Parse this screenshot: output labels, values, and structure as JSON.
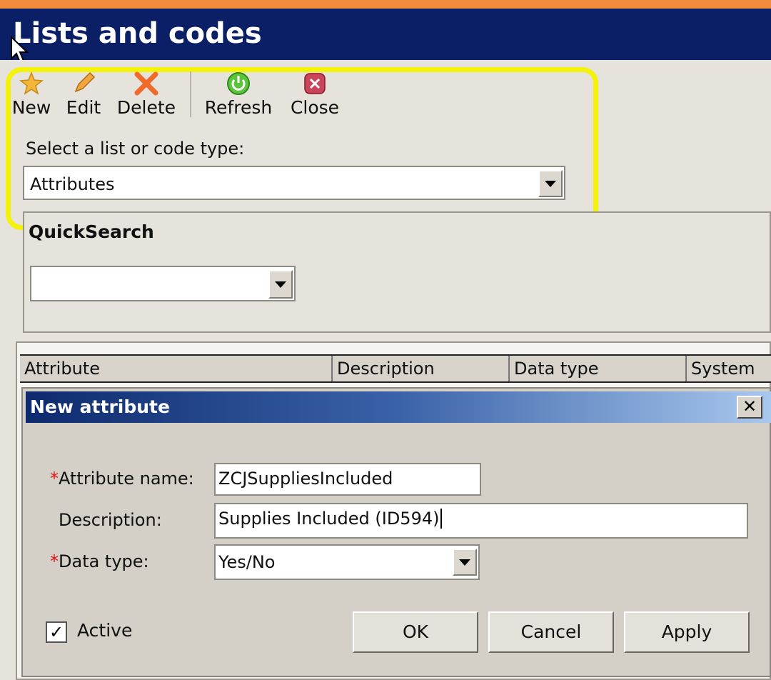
{
  "window": {
    "title": "Lists and codes"
  },
  "toolbar": {
    "new_label": "New",
    "edit_label": "Edit",
    "delete_label": "Delete",
    "refresh_label": "Refresh",
    "close_label": "Close"
  },
  "list_select": {
    "label": "Select a list or code type:",
    "value": "Attributes"
  },
  "quicksearch": {
    "label": "QuickSearch",
    "value": ""
  },
  "grid": {
    "columns": [
      "Attribute",
      "Description",
      "Data type",
      "System"
    ]
  },
  "dialog": {
    "title": "New attribute",
    "close_glyph": "✕",
    "required_mark": "*",
    "attribute_name_label": "Attribute name:",
    "attribute_name_value": "ZCJSuppliesIncluded",
    "description_label": "Description:",
    "description_value": "Supplies Included (ID594)",
    "data_type_label": "Data type:",
    "data_type_value": "Yes/No",
    "active_label": "Active",
    "active_checked": true,
    "check_glyph": "✓",
    "ok_label": "OK",
    "cancel_label": "Cancel",
    "apply_label": "Apply"
  },
  "colors": {
    "title_bar": "#0b1f66",
    "highlight": "#f4f20a",
    "accent_top": "#f08a3c"
  }
}
